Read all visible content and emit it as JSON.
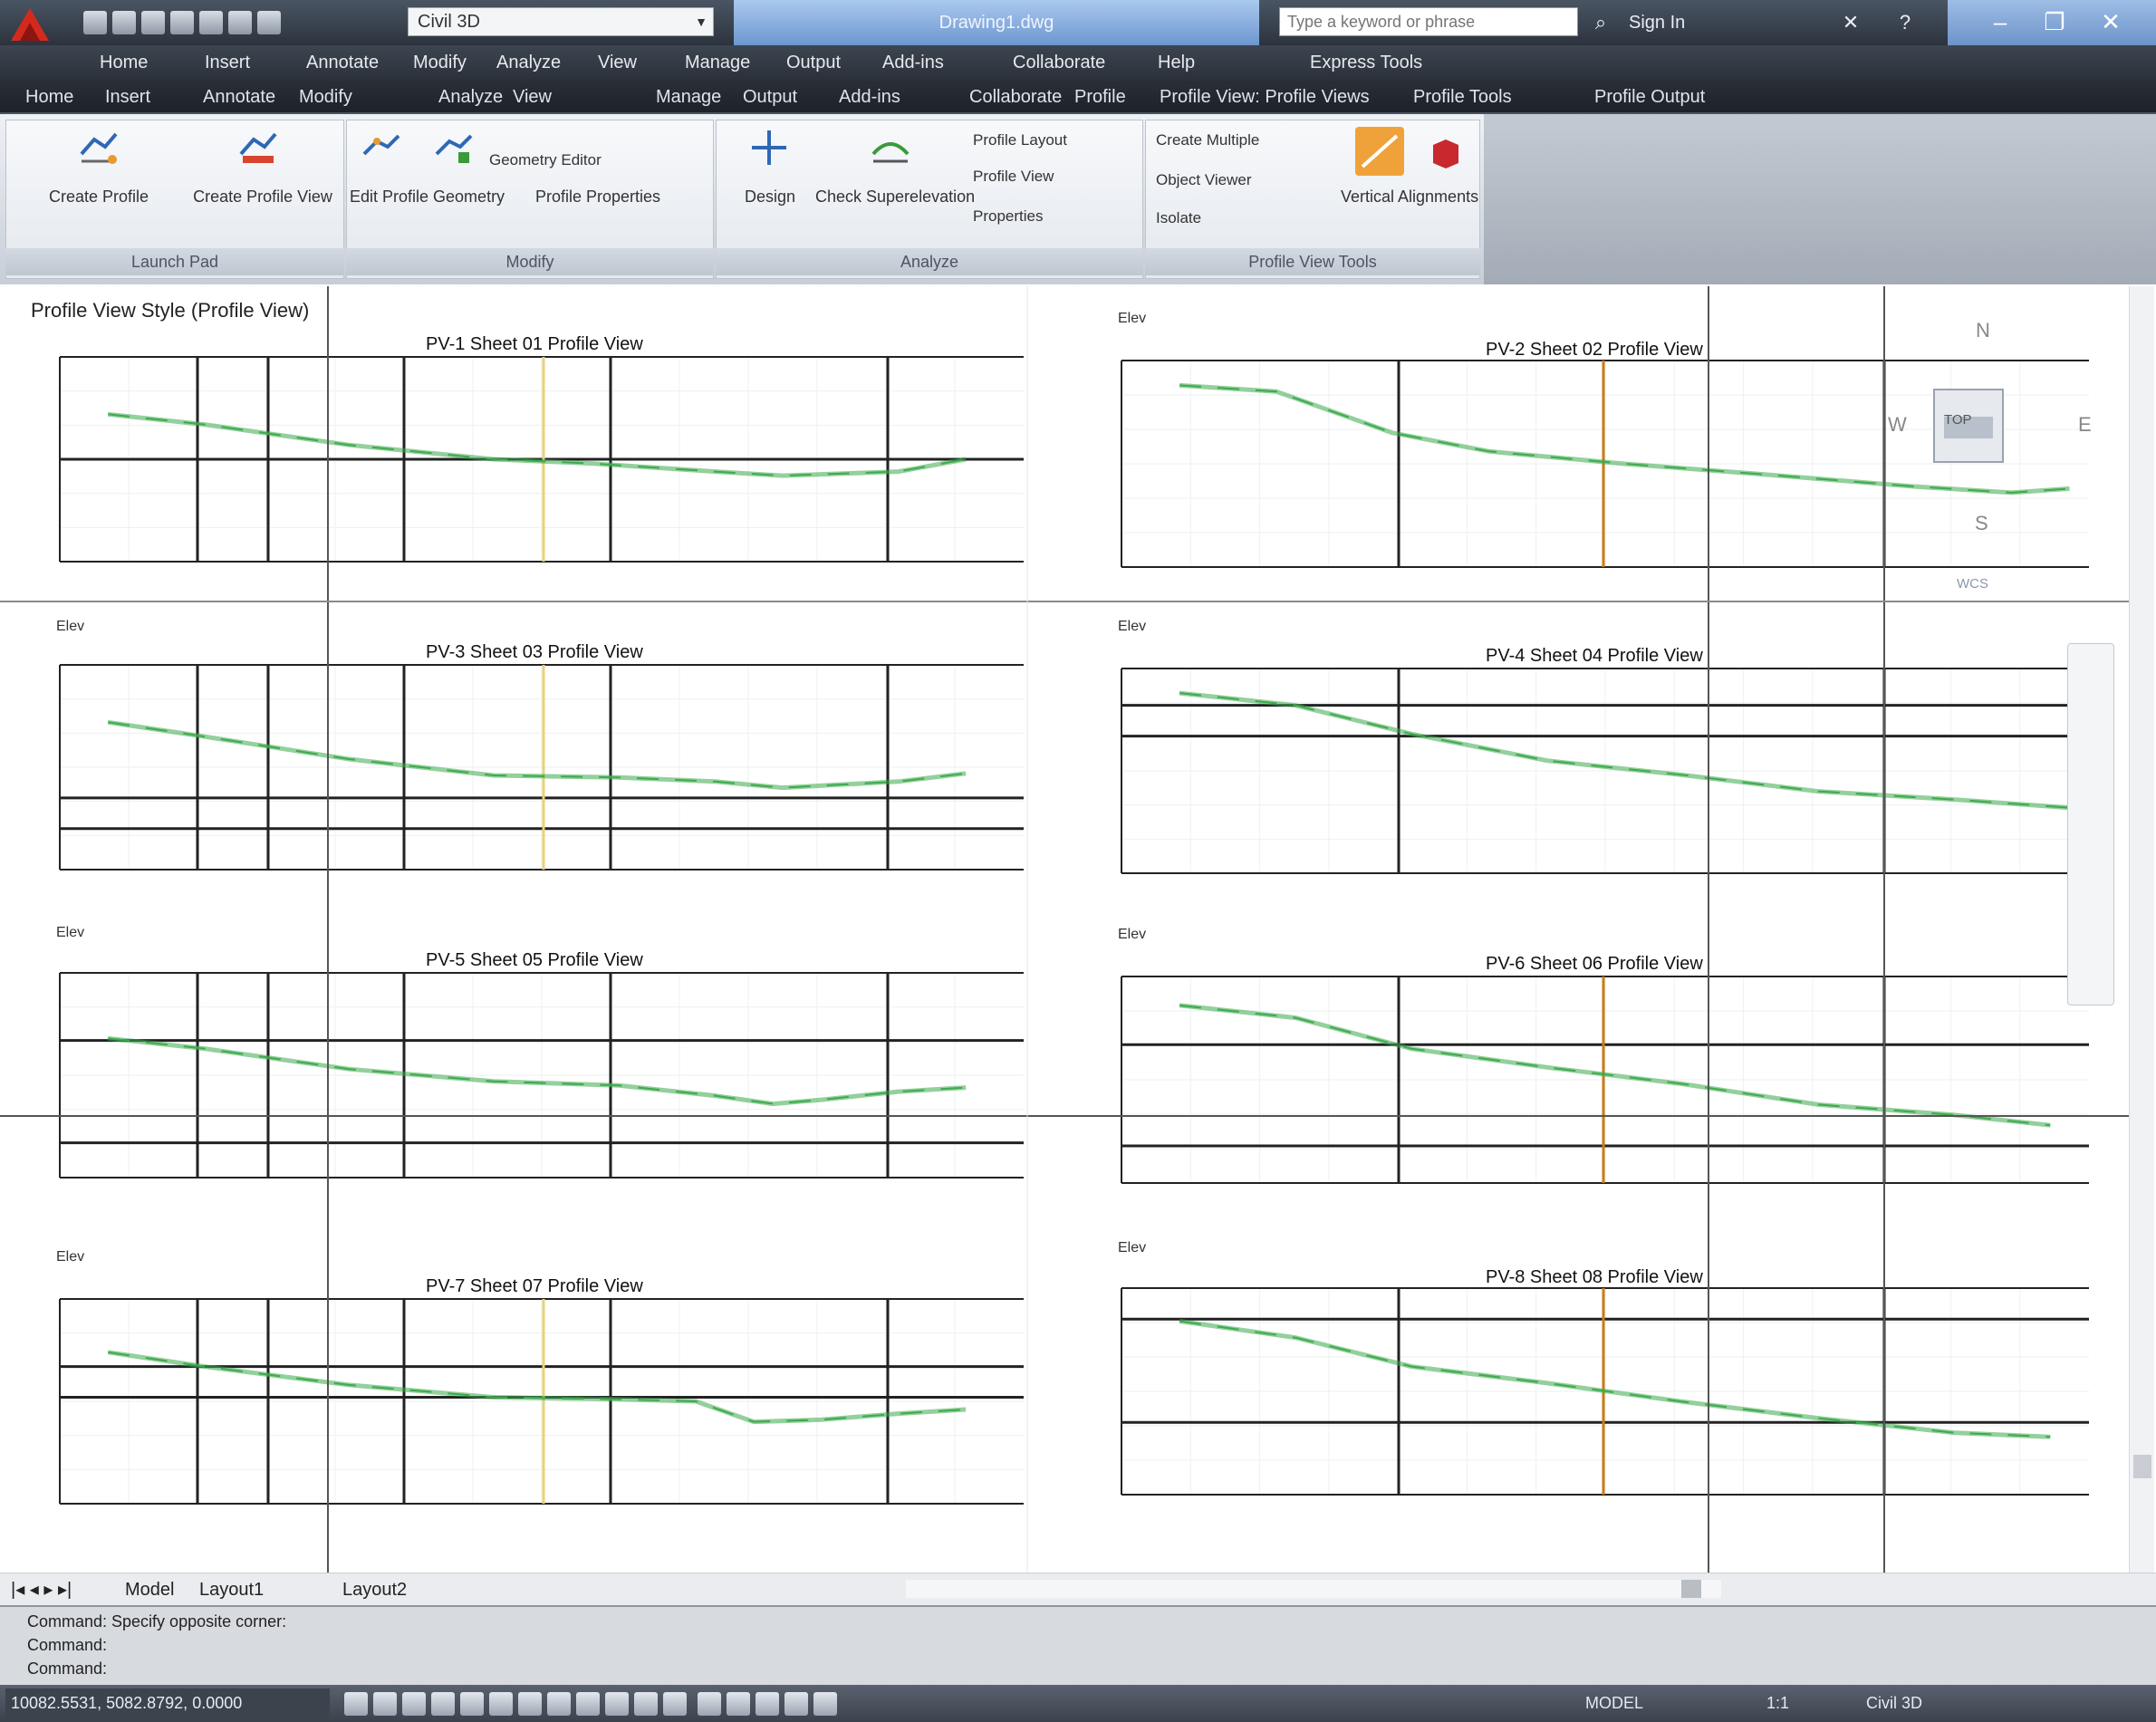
{
  "app": {
    "title": "Drawing1.dwg",
    "workspace": "Civil 3D",
    "search_placeholder": "Type a keyword or phrase",
    "user": "Sign In"
  },
  "menu": {
    "items": [
      "Home",
      "Insert",
      "Annotate",
      "Modify",
      "Analyze",
      "View",
      "Manage",
      "Output",
      "Add-ins",
      "Collaborate",
      "Help",
      "Express Tools"
    ],
    "tabs": [
      "Home",
      "Insert",
      "Annotate",
      "Modify",
      "Analyze",
      "View",
      "Manage",
      "Output",
      "Add-ins",
      "Collaborate",
      "Profile",
      "Profile View: Profile Views",
      "Profile Tools",
      "Profile Output"
    ]
  },
  "ribbon": {
    "panels": [
      {
        "title": "Launch Pad",
        "buttons": [
          "Create Profile",
          "Create Profile View"
        ]
      },
      {
        "title": "Modify",
        "buttons": [
          "Geometry Editor",
          "Edit Profile Geometry",
          "Profile Properties"
        ]
      },
      {
        "title": "Analyze",
        "buttons": [
          "Design",
          "Check Superelevation",
          "Profile Layout",
          "Profile View",
          "Properties"
        ]
      },
      {
        "title": "Profile View Tools",
        "buttons": [
          "Create Multiple",
          "Object Viewer",
          "Isolate",
          "Vertical Alignments"
        ]
      }
    ]
  },
  "drawing": {
    "caption": "Profile View Style (Profile View)",
    "plots": [
      {
        "title": "PV-1 Sheet 01 Profile View",
        "tag": ""
      },
      {
        "title": "PV-2 Sheet 02 Profile View",
        "tag": "Elev"
      },
      {
        "title": "PV-3 Sheet 03 Profile View",
        "tag": "Elev"
      },
      {
        "title": "PV-4 Sheet 04 Profile View",
        "tag": "Elev"
      },
      {
        "title": "PV-5 Sheet 05 Profile View",
        "tag": "Elev"
      },
      {
        "title": "PV-6 Sheet 06 Profile View",
        "tag": "Elev"
      },
      {
        "title": "PV-7 Sheet 07 Profile View",
        "tag": "Elev"
      },
      {
        "title": "PV-8 Sheet 08 Profile View",
        "tag": "Elev"
      }
    ],
    "viewcube": {
      "north": "N",
      "face": "TOP",
      "south": "S",
      "west": "W",
      "east": "E",
      "wcs": "WCS"
    },
    "colors": {
      "profile": "#3daa4c",
      "grid": "#222222",
      "marker_orange": "#c97d14",
      "marker_yellow": "#e8d27a"
    }
  },
  "layout_tabs": [
    "Model",
    "Layout1",
    "Layout2"
  ],
  "command": {
    "lines": [
      "Command: Specify opposite corner:",
      "Command:",
      "Command:"
    ]
  },
  "status": {
    "coordinates": "10082.5531, 5082.8792, 0.0000",
    "right_items": [
      "MODEL",
      "1:1",
      "Civil 3D"
    ]
  }
}
